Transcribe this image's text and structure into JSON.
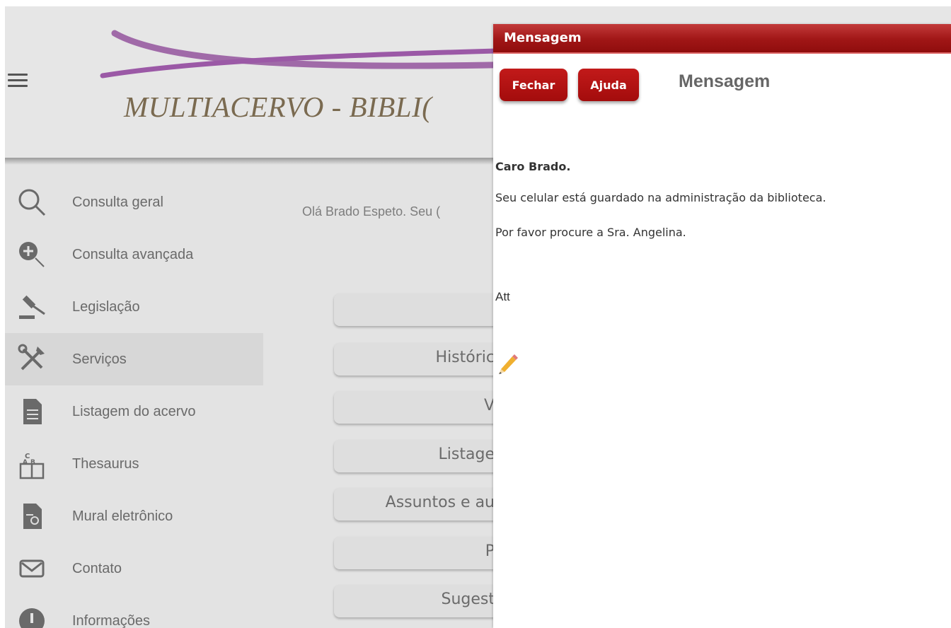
{
  "header": {
    "menu_icon": "hamburger-icon",
    "title": "MULTIACERVO - BIBLI("
  },
  "sidebar": {
    "items": [
      {
        "label": "Consulta geral",
        "icon": "search-icon"
      },
      {
        "label": "Consulta avançada",
        "icon": "zoom-in-icon"
      },
      {
        "label": "Legislação",
        "icon": "gavel-icon"
      },
      {
        "label": "Serviços",
        "icon": "tools-icon",
        "active": true
      },
      {
        "label": "Listagem do acervo",
        "icon": "document-list-icon"
      },
      {
        "label": "Thesaurus",
        "icon": "thesaurus-book-icon"
      },
      {
        "label": "Mural eletrônico",
        "icon": "certificate-document-icon"
      },
      {
        "label": "Contato",
        "icon": "envelope-icon"
      },
      {
        "label": "Informações",
        "icon": "info-icon"
      }
    ]
  },
  "main": {
    "greeting": "Olá Brado Espeto. Seu (",
    "service_buttons": [
      "",
      "Históric",
      "V",
      "Listage",
      "Assuntos e au",
      "P",
      "Sugest"
    ]
  },
  "dialog": {
    "title": "Mensagem",
    "close_label": "Fechar",
    "help_label": "Ajuda",
    "heading": "Mensagem",
    "greeting": "Caro Brado.",
    "line1": "Seu celular está guardado na administração da biblioteca.",
    "line2": "Por favor procure a Sra. Angelina.",
    "signoff": "Att",
    "edit_icon": "pencil-icon"
  },
  "colors": {
    "dialog_accent": "#a30c0c",
    "logo_swoosh": "#9b59a6"
  }
}
